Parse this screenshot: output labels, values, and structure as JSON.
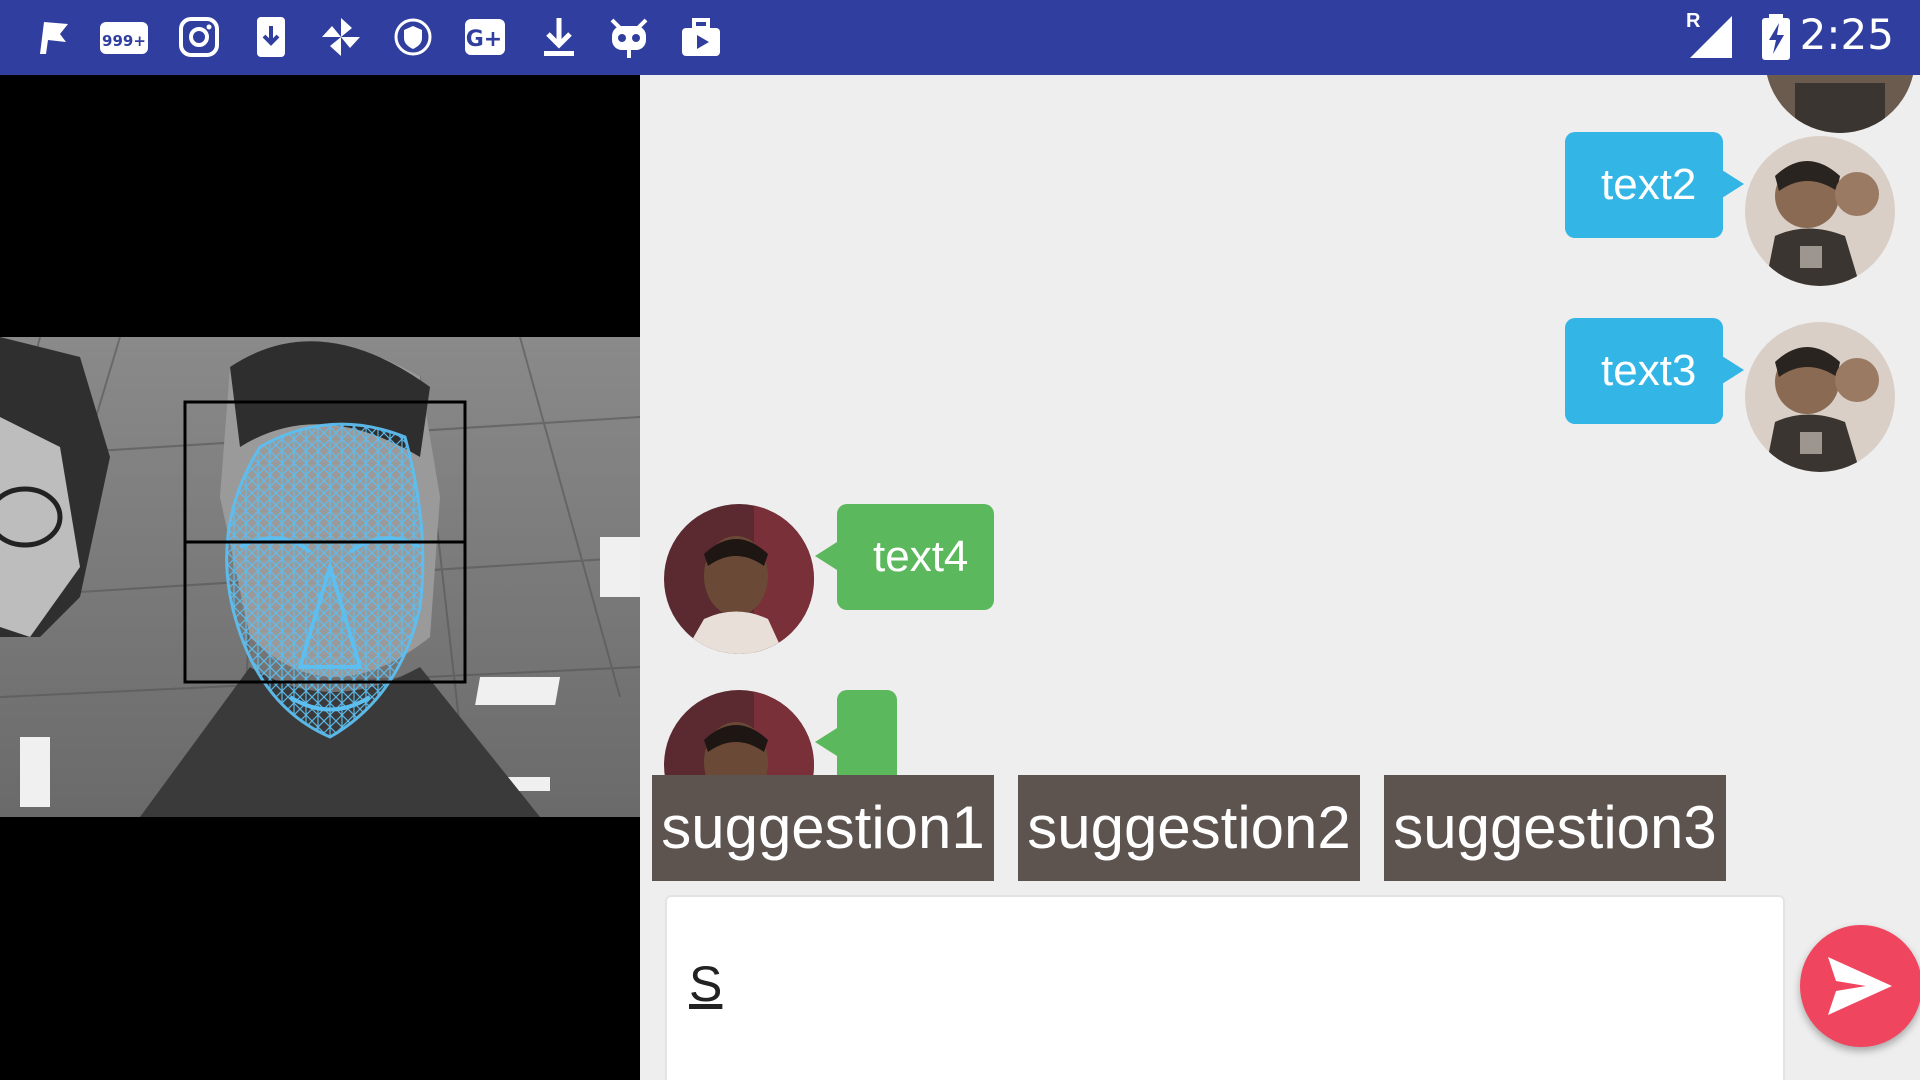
{
  "status_bar": {
    "time": "2:25",
    "roaming": "R",
    "notification_badge": "999+",
    "icons": [
      "flag-icon",
      "notification-count-icon",
      "instagram-icon",
      "download-app-icon",
      "pinwheel-icon",
      "shield-icon",
      "google-plus-icon",
      "download-icon",
      "cat-robot-icon",
      "media-share-icon"
    ],
    "right_icons": [
      "signal-icon",
      "battery-charging-icon"
    ]
  },
  "chat": {
    "messages": [
      {
        "sender": "me",
        "text": "text2"
      },
      {
        "sender": "me",
        "text": "text3"
      },
      {
        "sender": "other",
        "text": "text4"
      },
      {
        "sender": "other",
        "text": ""
      }
    ],
    "suggestions": [
      "suggestion1",
      "suggestion2",
      "suggestion3"
    ],
    "input_value": "S"
  },
  "colors": {
    "status_bar": "#303F9F",
    "me_bubble": "#33B5E5",
    "other_bubble": "#5CB85C",
    "suggestion_bg": "#5D5450",
    "send_button": "#F0455F",
    "face_mesh": "#5DBEF0"
  }
}
